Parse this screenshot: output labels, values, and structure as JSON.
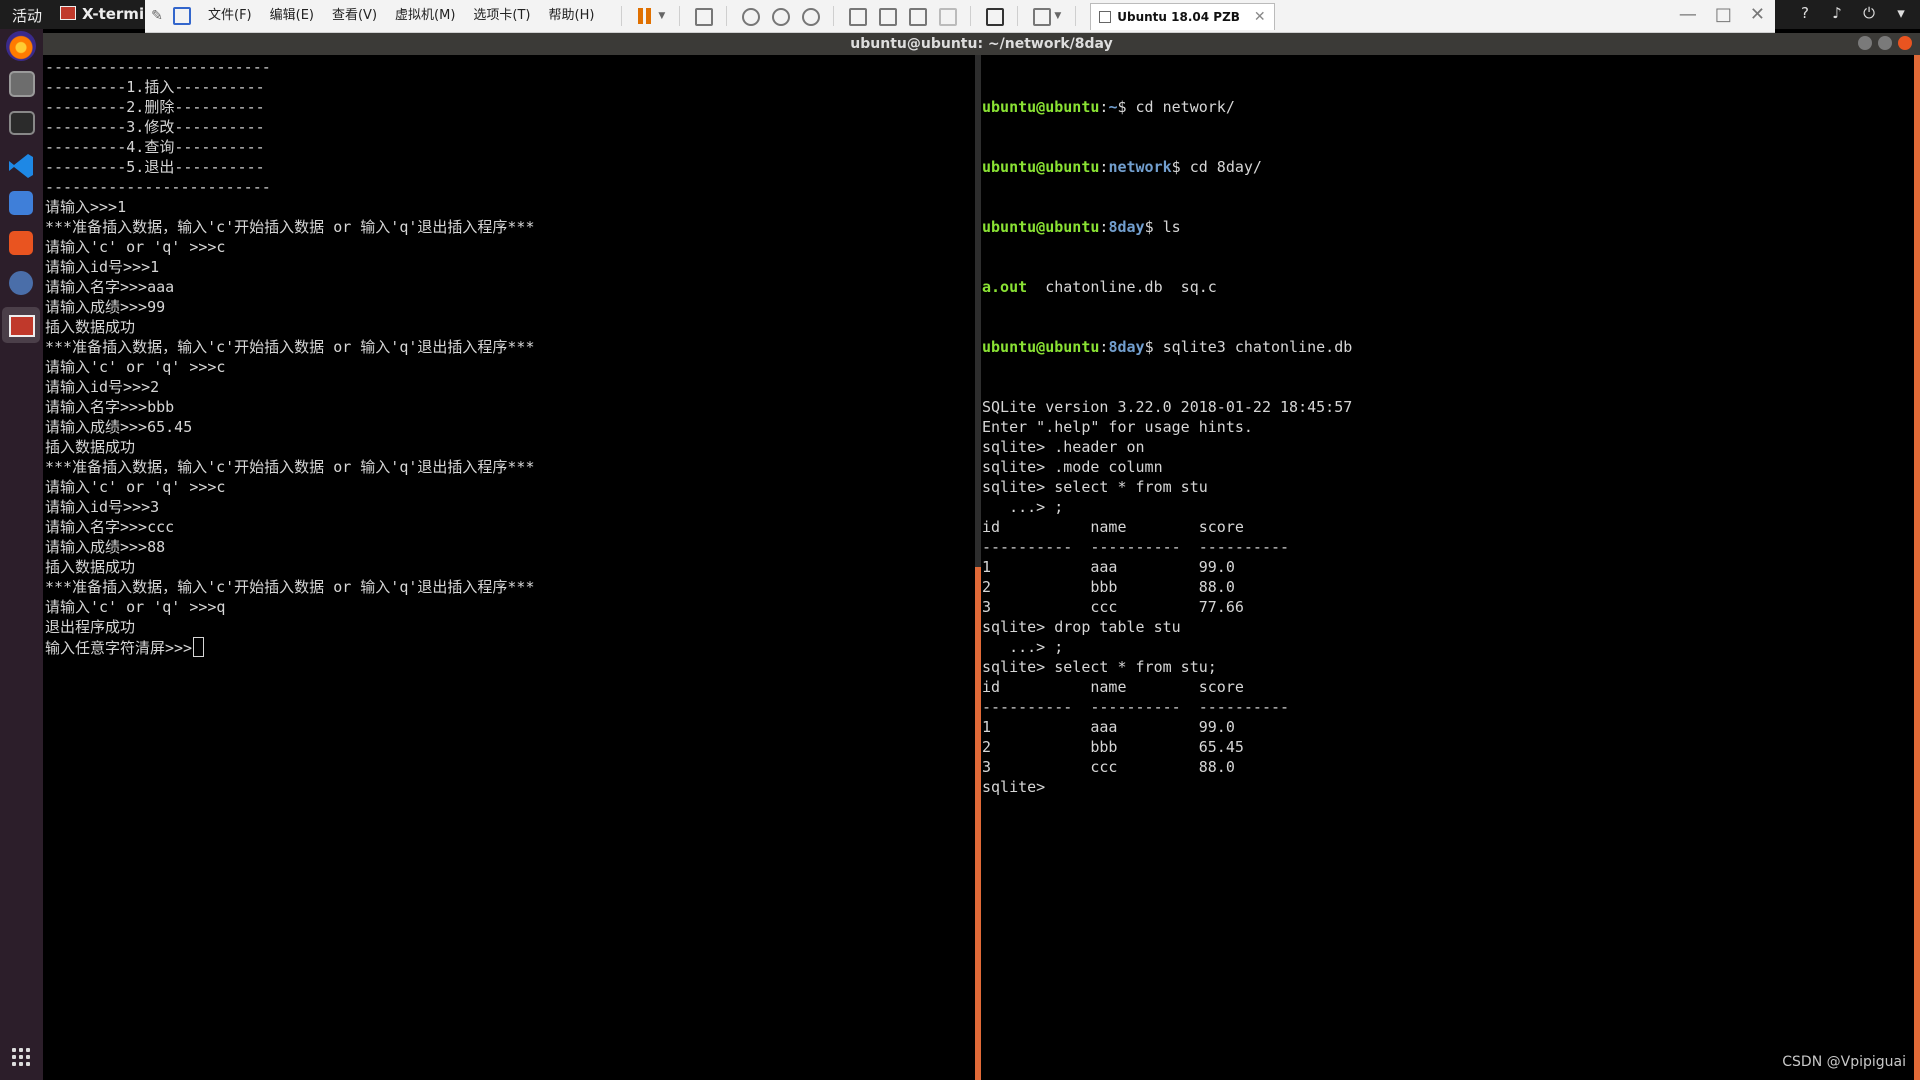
{
  "topbar": {
    "activities": "活动",
    "app_name": "X-termin",
    "tray_icons": [
      "help-icon",
      "volume-icon",
      "power-icon",
      "dropdown-icon"
    ]
  },
  "vmware": {
    "menu": [
      "文件(F)",
      "编辑(E)",
      "查看(V)",
      "虚拟机(M)",
      "选项卡(T)",
      "帮助(H)"
    ],
    "tab_title": "Ubuntu 18.04 PZB",
    "accent": "#e07000"
  },
  "terminal": {
    "title": "ubuntu@ubuntu: ~/network/8day",
    "left_lines": [
      "-------------------------",
      "---------1.插入----------",
      "---------2.删除----------",
      "---------3.修改----------",
      "---------4.查询----------",
      "---------5.退出----------",
      "-------------------------",
      "请输入>>>1",
      "***准备插入数据，输入'c'开始插入数据 or 输入'q'退出插入程序***",
      "请输入'c' or 'q' >>>c",
      "请输入id号>>>1",
      "请输入名字>>>aaa",
      "请输入成绩>>>99",
      "插入数据成功",
      "***准备插入数据，输入'c'开始插入数据 or 输入'q'退出插入程序***",
      "请输入'c' or 'q' >>>c",
      "请输入id号>>>2",
      "请输入名字>>>bbb",
      "请输入成绩>>>65.45",
      "插入数据成功",
      "***准备插入数据，输入'c'开始插入数据 or 输入'q'退出插入程序***",
      "请输入'c' or 'q' >>>c",
      "请输入id号>>>3",
      "请输入名字>>>ccc",
      "请输入成绩>>>88",
      "插入数据成功",
      "***准备插入数据，输入'c'开始插入数据 or 输入'q'退出插入程序***",
      "请输入'c' or 'q' >>>q",
      "退出程序成功"
    ],
    "left_prompt": "输入任意字符清屏>>>",
    "right_prompt_user": "ubuntu@ubuntu",
    "right_cmds": [
      {
        "path": "~",
        "cmd": " cd network/"
      },
      {
        "path": "network",
        "cmd": " cd 8day/"
      },
      {
        "path": "8day",
        "cmd": " ls"
      }
    ],
    "ls_exec": "a.out",
    "ls_rest": "  chatonline.db  sq.c",
    "sqlite_cmd": {
      "path": "8day",
      "cmd": " sqlite3 chatonline.db"
    },
    "right_lines": [
      "SQLite version 3.22.0 2018-01-22 18:45:57",
      "Enter \".help\" for usage hints.",
      "sqlite> .header on",
      "sqlite> .mode column",
      "sqlite> select * from stu",
      "   ...> ;",
      "id          name        score",
      "----------  ----------  ----------",
      "1           aaa         99.0",
      "2           bbb         88.0",
      "3           ccc         77.66",
      "sqlite> drop table stu",
      "   ...> ;",
      "sqlite> select * from stu;",
      "id          name        score",
      "----------  ----------  ----------",
      "1           aaa         99.0",
      "2           bbb         65.45",
      "3           ccc         88.0",
      "sqlite>"
    ]
  },
  "watermark": "CSDN @Vpipiguai",
  "colors": {
    "user_green": "#8ae234",
    "path_blue": "#729fcf",
    "ubuntu_orange": "#e95420",
    "dock_bg": "#2c1e2a"
  }
}
